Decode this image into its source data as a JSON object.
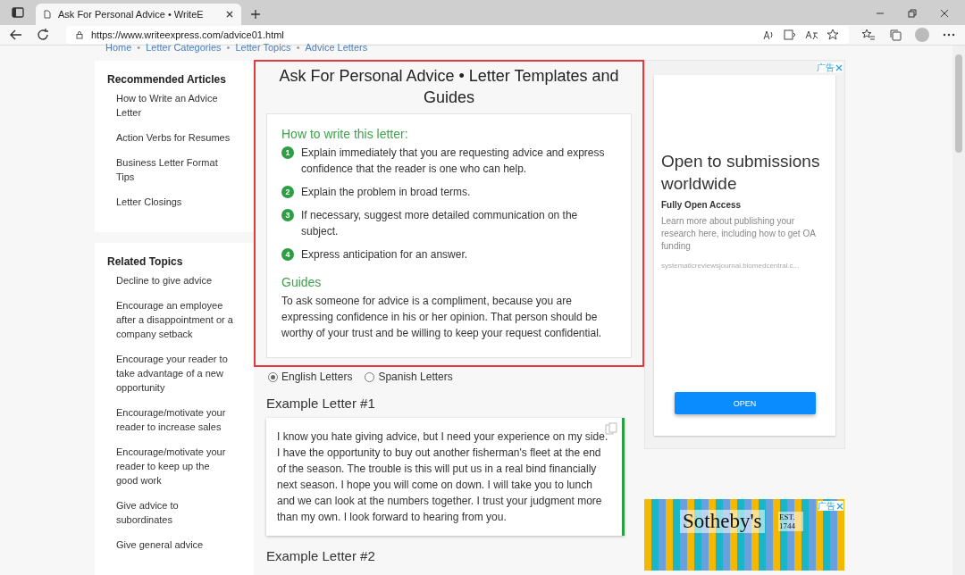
{
  "browser": {
    "tab_title": "Ask For Personal Advice • WriteE",
    "url": "https://www.writeexpress.com/advice01.html"
  },
  "breadcrumb": {
    "separator": "•",
    "items": [
      "Home",
      "Letter Categories",
      "Letter Topics",
      "Advice Letters"
    ]
  },
  "sidebar": [
    {
      "title": "Recommended Articles",
      "items": [
        "How to Write an Advice Letter",
        "Action Verbs for Resumes",
        "Business Letter Format Tips",
        "Letter Closings"
      ]
    },
    {
      "title": "Related Topics",
      "items": [
        "Decline to give advice",
        "Encourage an employee after a disappointment or a company setback",
        "Encourage your reader to take advantage of a new opportunity",
        "Encourage/motivate your reader to increase sales",
        "Encourage/motivate your reader to keep up the good work",
        "Give advice to subordinates",
        "Give general advice"
      ]
    }
  ],
  "main": {
    "title": "Ask For Personal Advice • Letter Templates and Guides",
    "how_to": {
      "heading": "How to write this letter:",
      "steps": [
        {
          "number": "1",
          "text": "Explain immediately that you are requesting advice and express confidence that the reader is one who can help."
        },
        {
          "number": "2",
          "text": "Explain the problem in broad terms."
        },
        {
          "number": "3",
          "text": "If necessary, suggest more detailed communication on the subject."
        },
        {
          "number": "4",
          "text": "Express anticipation for an answer."
        }
      ]
    },
    "guides": {
      "heading": "Guides",
      "text": "To ask someone for advice is a compliment, because you are expressing confidence in his or her opinion. That person should be worthy of your trust and be willing to keep your request confidential."
    },
    "language_options": [
      {
        "label": "English Letters",
        "selected": true
      },
      {
        "label": "Spanish Letters",
        "selected": false
      }
    ],
    "examples": [
      {
        "title": "Example Letter #1",
        "body": "I know you hate giving advice, but I need your experience on my side. I have the opportunity to buy out another fisherman's fleet at the end of the season. The trouble is this will put us in a real bind financially next season. I hope you will come on down. I will take you to lunch and we can look at the numbers together. I trust your judgment more than my own. I look forward to hearing from you."
      },
      {
        "title": "Example Letter #2"
      }
    ]
  },
  "ads": [
    {
      "kind": "text",
      "label": "广告",
      "headline": "Open to submissions worldwide",
      "subhead": "Fully Open Access",
      "body": "Learn more about publishing your research here, including how to get OA funding",
      "domain": "systematicreviewsjournal.biomedcentral.c...",
      "button": "OPEN"
    },
    {
      "kind": "banner",
      "label": "广告",
      "brand": "Sotheby's",
      "est": "EST. 1744"
    }
  ]
}
